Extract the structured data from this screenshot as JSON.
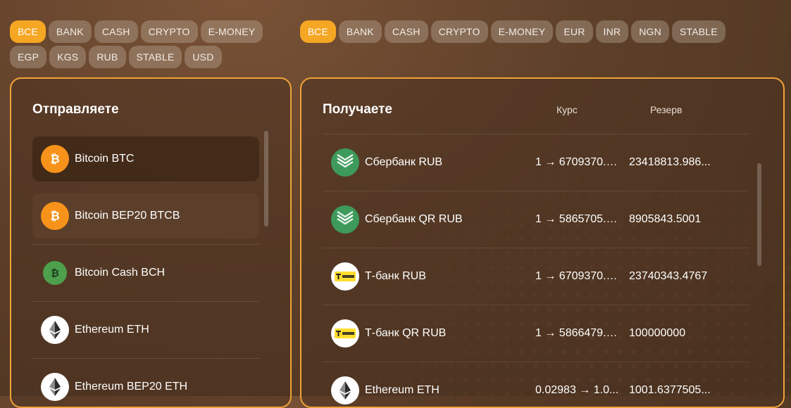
{
  "left_filters": [
    {
      "label": "ВСЕ",
      "active": true
    },
    {
      "label": "BANK"
    },
    {
      "label": "CASH"
    },
    {
      "label": "CRYPTO"
    },
    {
      "label": "E-MONEY"
    },
    {
      "label": "EGP"
    },
    {
      "label": "KGS"
    },
    {
      "label": "RUB"
    },
    {
      "label": "STABLE"
    },
    {
      "label": "USD"
    }
  ],
  "right_filters": [
    {
      "label": "ВСЕ",
      "active": true
    },
    {
      "label": "BANK"
    },
    {
      "label": "CASH"
    },
    {
      "label": "CRYPTO"
    },
    {
      "label": "E-MONEY"
    },
    {
      "label": "EUR"
    },
    {
      "label": "INR"
    },
    {
      "label": "NGN"
    },
    {
      "label": "STABLE"
    }
  ],
  "send_panel": {
    "title": "Отправляете",
    "items": [
      {
        "label": "Bitcoin BTC",
        "icon": "bitcoin-icon"
      },
      {
        "label": "Bitcoin BEP20 BTCB",
        "icon": "bitcoin-icon"
      },
      {
        "label": "Bitcoin Cash BCH",
        "icon": "bitcoin-cash-icon"
      },
      {
        "label": "Ethereum ETH",
        "icon": "ethereum-icon"
      },
      {
        "label": "Ethereum BEP20 ETH",
        "icon": "ethereum-icon"
      }
    ]
  },
  "receive_panel": {
    "title": "Получаете",
    "col_rate": "Курс",
    "col_reserve": "Резерв",
    "rows": [
      {
        "name": "Сбербанк RUB",
        "rate": "1 → 6709370.3...",
        "reserve": "23418813.986...",
        "icon": "sberbank-icon"
      },
      {
        "name": "Сбербанк QR RUB",
        "rate": "1 → 5865705.0...",
        "reserve": "8905843.5001",
        "icon": "sberbank-icon"
      },
      {
        "name": "Т-банк RUB",
        "rate": "1 → 6709370.3...",
        "reserve": "23740343.4767",
        "icon": "tbank-icon"
      },
      {
        "name": "Т-банк QR RUB",
        "rate": "1 → 5866479.0...",
        "reserve": "100000000",
        "icon": "tbank-icon"
      },
      {
        "name": "Ethereum ETH",
        "rate": "0.02983 → 1.0...",
        "reserve": "1001.6377505...",
        "icon": "ethereum-icon"
      }
    ]
  },
  "colors": {
    "accent": "#f5a623",
    "panel_border": "#f0a33a"
  }
}
